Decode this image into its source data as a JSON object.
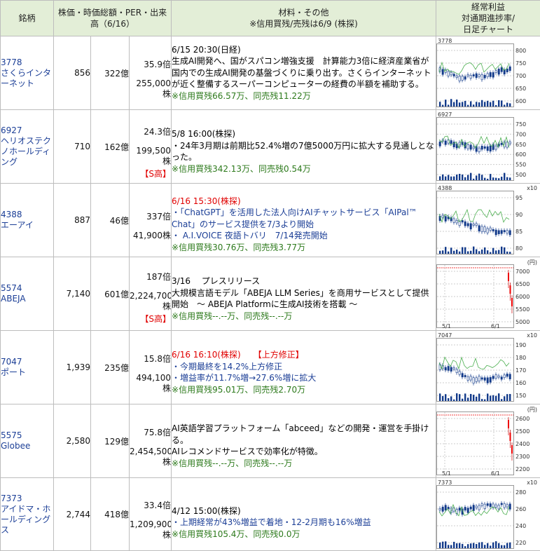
{
  "header": {
    "col_name": "銘柄",
    "col_price": "株価・時価総額・PER・出来高（6/16）",
    "col_news_line1": "材料・その他",
    "col_news_line2": "※信用買残/売残は6/9 (株探)",
    "col_chart_line1": "経常利益",
    "col_chart_line2": "対通期進捗率/",
    "col_chart_line3": "日足チャート"
  },
  "rows": [
    {
      "code": "3778",
      "name": "さくらインターネット",
      "price": "856",
      "mcap": "322億",
      "per": "35.9倍",
      "volume": "255,000株",
      "s_high": "",
      "date": "6/15 20:30(日経)",
      "body": "生成AI開発へ、国がスパコン増強支援　計算能力3倍に経済産業省が国内での生成AI開発の基盤づくりに乗り出す。さくらインターネットが近く整備するスーパーコンピューターの経費の半額を補助する。",
      "margin": "※信用買残66.57万、同売残11.22万",
      "chart_code": "3778",
      "chart_unit": "",
      "axis_labels": [
        "800",
        "750",
        "700",
        "650",
        "600"
      ]
    },
    {
      "code": "6927",
      "name": "ヘリオステクノホールディング",
      "price": "710",
      "mcap": "162億",
      "per": "24.3倍",
      "volume": "199,500株",
      "s_high": "【S高】",
      "date": "5/8 16:00(株探)",
      "body": "・24年3月期は前期比52.4%増の7億5000万円に拡大する見通しとなった。",
      "margin": "※信用買残342.13万、同売残0.54万",
      "chart_code": "6927",
      "chart_unit": "",
      "axis_labels": [
        "750",
        "700",
        "650",
        "600",
        "550",
        "500"
      ]
    },
    {
      "code": "4388",
      "name": "エーアイ",
      "price": "887",
      "mcap": "46億",
      "per": "337倍",
      "volume": "41,900株",
      "s_high": "",
      "date": "6/16 15:30(株探)",
      "body_lines": [
        "・「ChatGPT」を活用した法人向けAIチャットサービス「AIPal™ Chat」のサービス提供を7/3より開始",
        "・ A.I.VOICE 夜語トバリ　7/14発売開始"
      ],
      "margin": "※信用買残30.76万、同売残3.77万",
      "chart_code": "4388",
      "chart_unit": "x10",
      "axis_labels": [
        "95",
        "90",
        "85",
        "80"
      ]
    },
    {
      "code": "5574",
      "name": "ABEJA",
      "price": "7,140",
      "mcap": "601億",
      "per": "187倍",
      "volume": "2,224,700株",
      "s_high": "【S高】",
      "date": "3/16　 プレスリリース",
      "body": "大規模言語モデル「ABEJA LLM Series」を商用サービスとして提供開始　～ ABEJA Platformに生成AI技術を搭載 ～",
      "margin": "※信用買残--.--万、同売残--.--万",
      "chart_code": "",
      "chart_unit": "(円)",
      "axis_labels": [
        "7000",
        "6500",
        "6000",
        "5500",
        "5000"
      ],
      "x_labels": [
        "5/1",
        "6/1"
      ]
    },
    {
      "code": "7047",
      "name": "ポート",
      "price": "1,939",
      "mcap": "235億",
      "per": "15.8倍",
      "volume": "494,100株",
      "s_high": "",
      "date": "6/16 16:10(株探)",
      "tag": "【上方修正】",
      "body_lines": [
        "・今期最終を14.2%上方修正",
        "・増益率が11.7%増→27.6%増に拡大"
      ],
      "margin": "※信用買残95.01万、同売残2.70万",
      "chart_code": "7047",
      "chart_unit": "x10",
      "axis_labels": [
        "190",
        "180",
        "170",
        "160",
        "150"
      ]
    },
    {
      "code": "5575",
      "name": "Globee",
      "price": "2,580",
      "mcap": "129億",
      "per": "75.8倍",
      "volume": "2,454,500株",
      "s_high": "",
      "date": "",
      "body_lines": [
        "AI英語学習プラットフォーム「abceed」などの開発・運営を手掛ける。",
        "AIレコメンドサービスで効率化が特徴。"
      ],
      "margin": "※信用買残--.--万、同売残--.--万",
      "chart_code": "",
      "chart_unit": "(円)",
      "axis_labels": [
        "2600",
        "2500",
        "2400",
        "2300",
        "2200"
      ],
      "x_labels": [
        "5/1",
        "6/1"
      ]
    },
    {
      "code": "7373",
      "name": "アイドマ・ホールディングス",
      "price": "2,744",
      "mcap": "418億",
      "per": "33.4倍",
      "volume": "1,209,900株",
      "s_high": "",
      "date": "4/12 15:00(株探)",
      "body": "・上期経常が43%増益で着地・12-2月期も16%増益",
      "margin": "※信用買残105.4万、同売残0.0万",
      "chart_code": "7373",
      "chart_unit": "x10",
      "axis_labels": [
        "280",
        "260",
        "240",
        "220"
      ]
    }
  ]
}
